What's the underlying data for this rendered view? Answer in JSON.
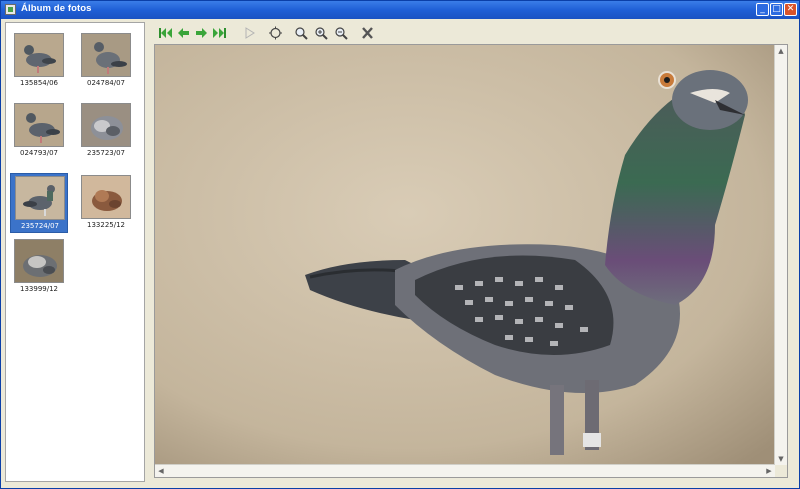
{
  "window": {
    "title": "Álbum de fotos",
    "controls": {
      "minimize": "_",
      "maximize": "□",
      "close": "✕"
    }
  },
  "thumbnails": [
    {
      "label": "135854/06",
      "selected": false
    },
    {
      "label": "024784/07",
      "selected": false
    },
    {
      "label": "024793/07",
      "selected": false
    },
    {
      "label": "235723/07",
      "selected": false
    },
    {
      "label": "235724/07",
      "selected": true
    },
    {
      "label": "133225/12",
      "selected": false
    },
    {
      "label": "133999/12",
      "selected": false
    }
  ],
  "toolbar": {
    "buttons": [
      {
        "name": "first-icon",
        "enabled": true
      },
      {
        "name": "previous-icon",
        "enabled": true
      },
      {
        "name": "next-icon",
        "enabled": true
      },
      {
        "name": "last-icon",
        "enabled": true
      },
      {
        "name": "play-icon",
        "enabled": false
      },
      {
        "name": "fit-icon",
        "enabled": true
      },
      {
        "name": "zoom-icon",
        "enabled": true
      },
      {
        "name": "zoom-in-icon",
        "enabled": true
      },
      {
        "name": "zoom-out-icon",
        "enabled": true
      },
      {
        "name": "delete-icon",
        "enabled": true
      }
    ]
  },
  "colors": {
    "titlebar": "#2a66d8",
    "selection": "#3b73c9",
    "nav_green": "#3aa53a"
  }
}
